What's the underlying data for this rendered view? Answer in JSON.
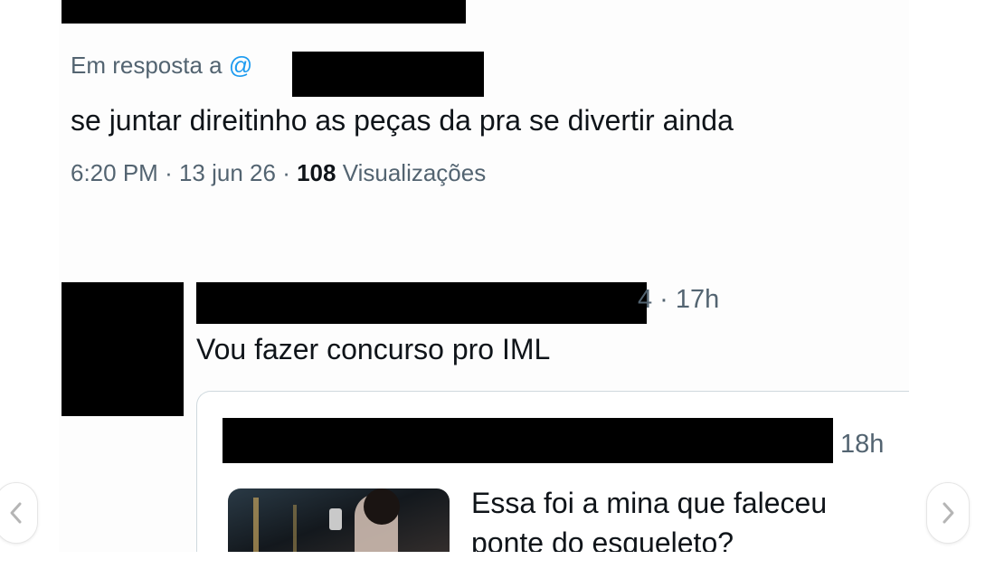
{
  "reply": {
    "in_reply_prefix": "Em resposta a",
    "at_sign": "@",
    "text": "se juntar direitinho as peças da pra se divertir ainda",
    "time": "6:20 PM",
    "sep1": "·",
    "date": "13 jun 26",
    "sep2": "·",
    "views_count": "108",
    "views_label": "Visualizações"
  },
  "quote_tweet": {
    "time_fragment": "4 · 17h",
    "text": "Vou fazer concurso pro IML"
  },
  "embedded_tweet": {
    "time": "18h",
    "text_line1": "Essa foi a mina que faleceu",
    "text_line2": "ponte do esqueleto?"
  },
  "carousel": {
    "prev_icon": "chevron-left-icon",
    "next_icon": "chevron-right-icon"
  },
  "colors": {
    "muted": "#536471",
    "link": "#1d9bf0",
    "text": "#0f1419",
    "redaction": "#000000"
  }
}
